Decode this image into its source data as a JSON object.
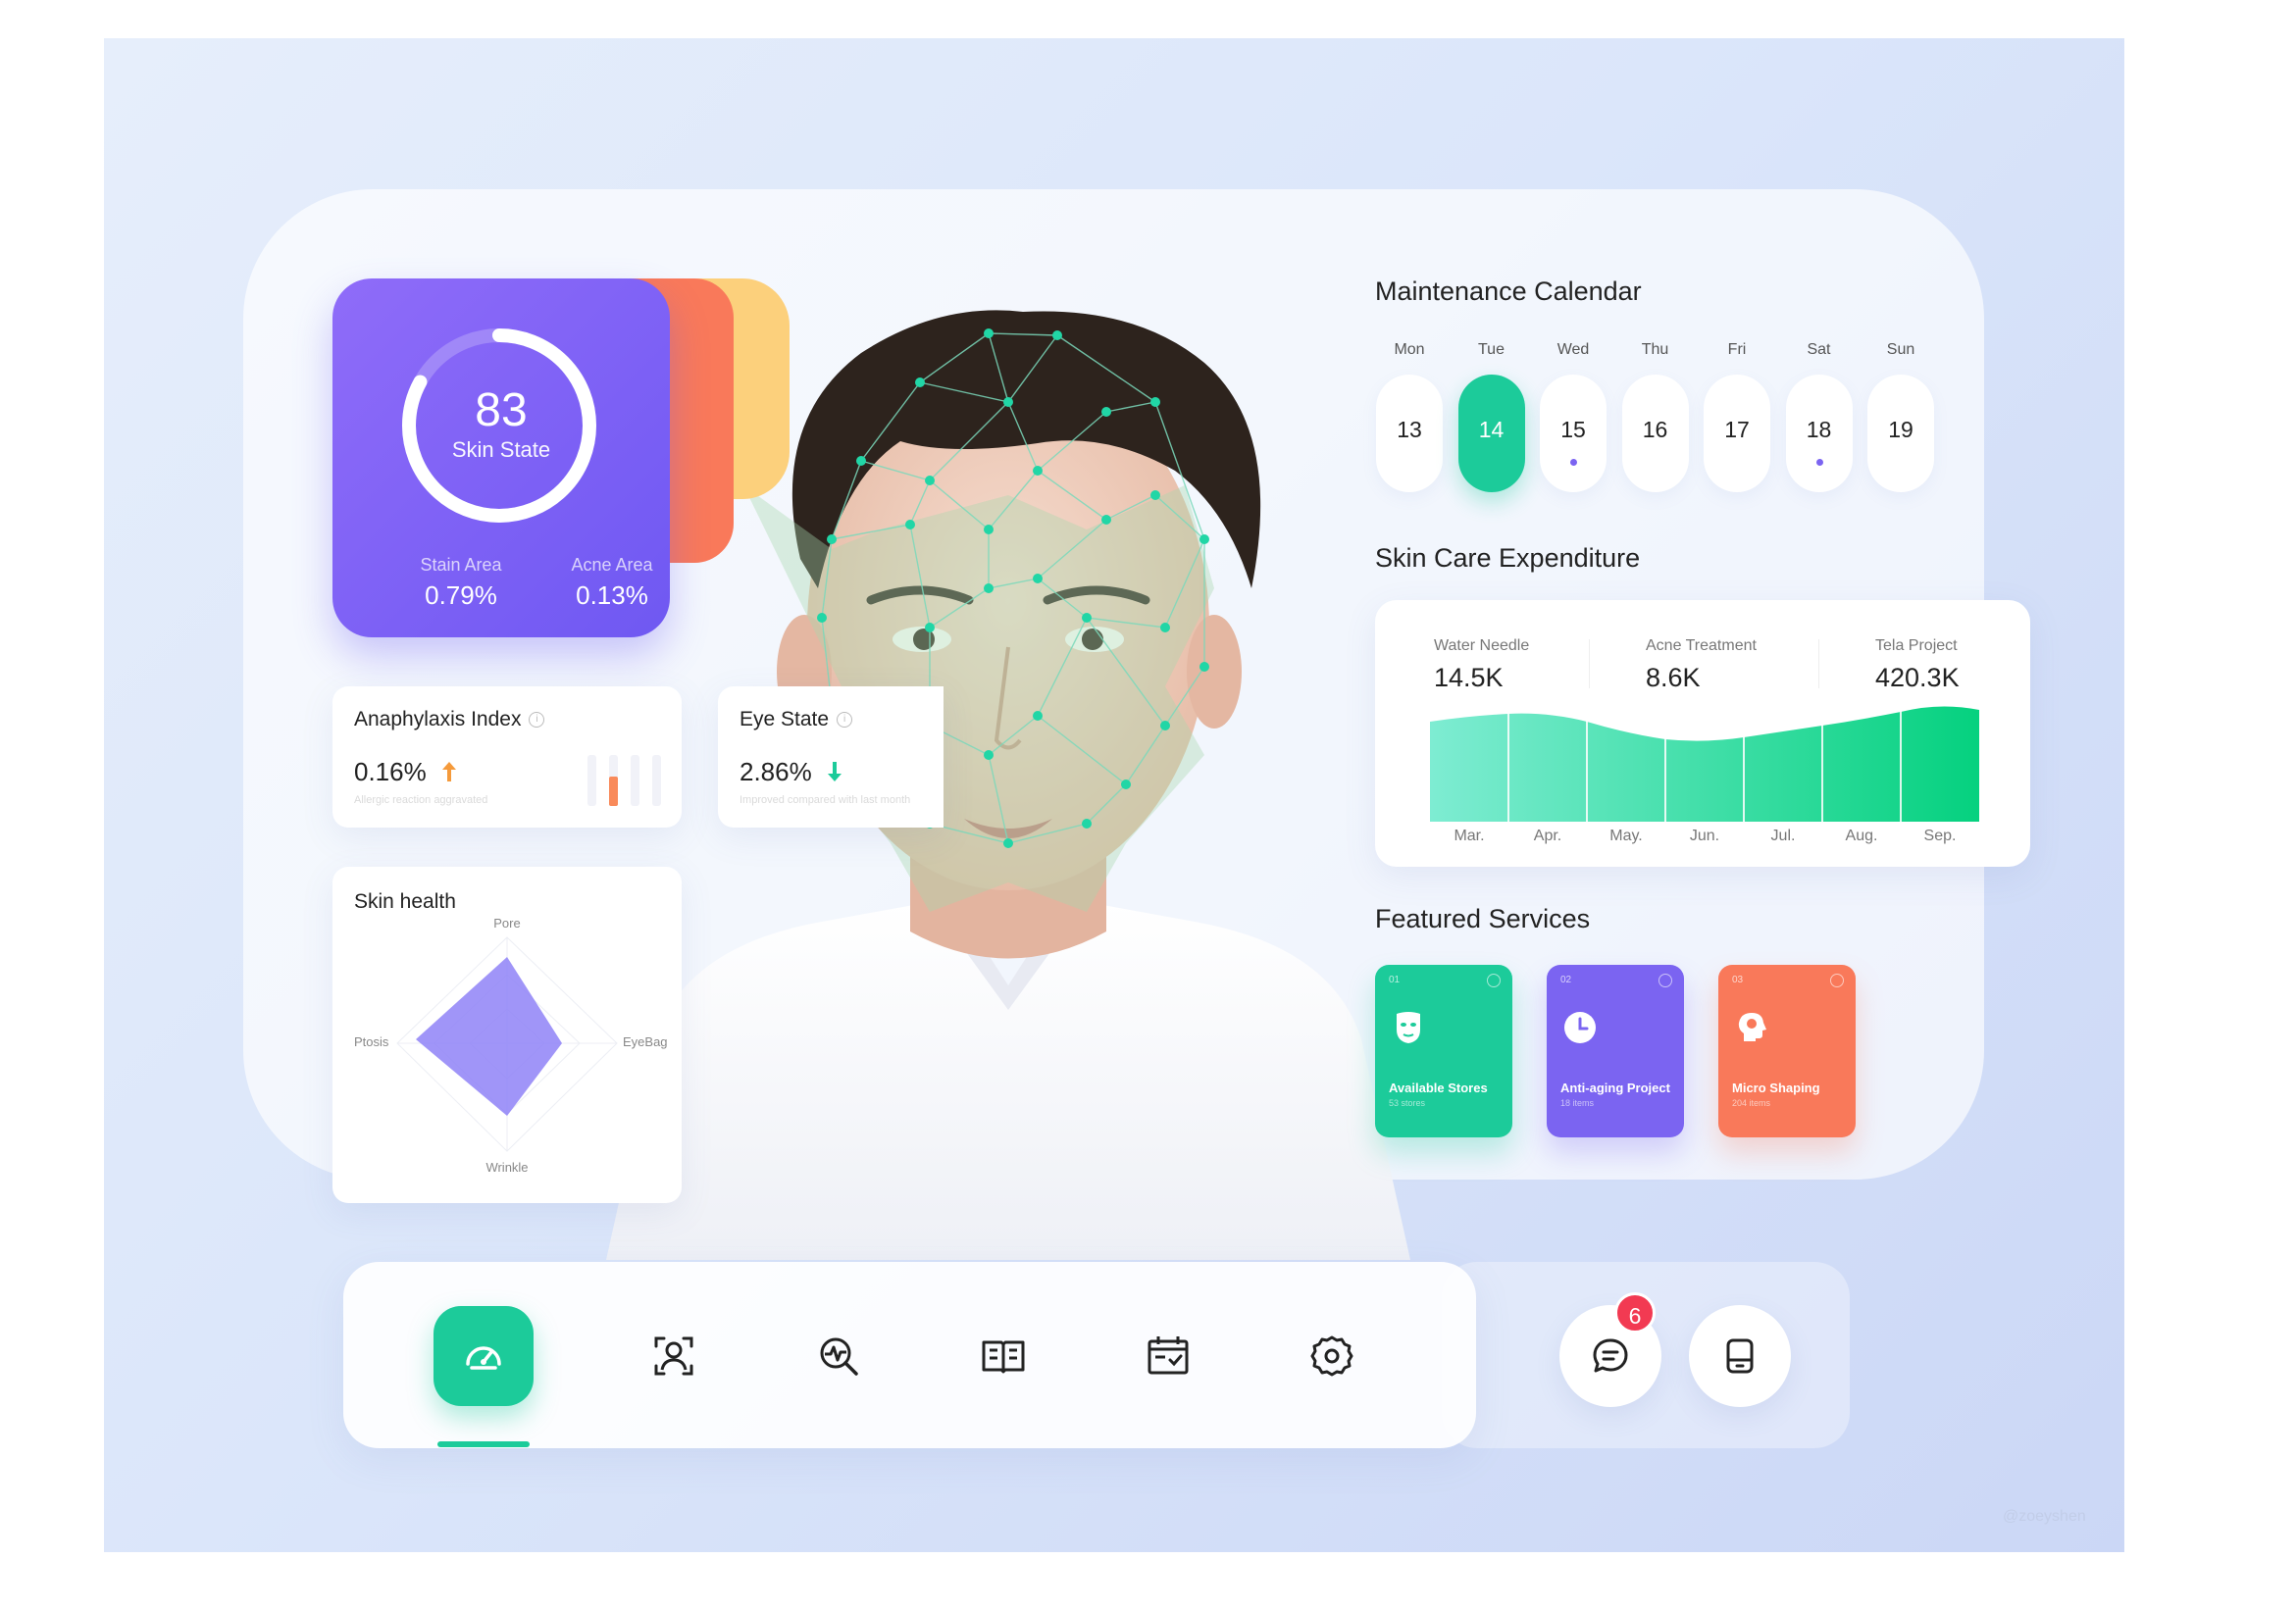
{
  "colors": {
    "accent_green": "#1ccb9a",
    "accent_purple": "#7b64f1",
    "accent_orange": "#f9795a",
    "accent_yellow": "#fcd07c",
    "badge_red": "#f23a52"
  },
  "skin_state": {
    "score": "83",
    "score_fraction": 0.83,
    "label": "Skin State",
    "stain_label": "Stain Area",
    "stain_value": "0.79%",
    "acne_label": "Acne Area",
    "acne_value": "0.13%"
  },
  "anaphylaxis": {
    "title": "Anaphylaxis Index",
    "value": "0.16%",
    "trend_icon": "arrow-up-icon",
    "note": "Allergic reaction aggravated"
  },
  "eye_state": {
    "title": "Eye State",
    "value": "2.86%",
    "trend_icon": "arrow-down-icon",
    "note": "Improved compared with last month"
  },
  "skin_health": {
    "title": "Skin health",
    "axes": [
      "Pore",
      "EyeBag",
      "Wrinkle",
      "Ptosis"
    ]
  },
  "calendar": {
    "title": "Maintenance Calendar",
    "days": [
      {
        "name": "Mon",
        "num": "13",
        "active": false,
        "dot": false
      },
      {
        "name": "Tue",
        "num": "14",
        "active": true,
        "dot": false
      },
      {
        "name": "Wed",
        "num": "15",
        "active": false,
        "dot": true
      },
      {
        "name": "Thu",
        "num": "16",
        "active": false,
        "dot": false
      },
      {
        "name": "Fri",
        "num": "17",
        "active": false,
        "dot": false
      },
      {
        "name": "Sat",
        "num": "18",
        "active": false,
        "dot": true
      },
      {
        "name": "Sun",
        "num": "19",
        "active": false,
        "dot": false
      }
    ]
  },
  "expenditure": {
    "title": "Skin Care Expenditure",
    "stats": [
      {
        "label": "Water Needle",
        "value": "14.5K"
      },
      {
        "label": "Acne Treatment",
        "value": "8.6K"
      },
      {
        "label": "Tela Project",
        "value": "420.3K"
      }
    ],
    "months": [
      "Mar.",
      "Apr.",
      "May.",
      "Jun.",
      "Jul.",
      "Aug.",
      "Sep."
    ]
  },
  "featured": {
    "title": "Featured Services",
    "services": [
      {
        "num": "01",
        "name": "Available Stores",
        "sub": "53 stores",
        "color": "#1ccb9a",
        "icon": "mask-icon"
      },
      {
        "num": "02",
        "name": "Anti-aging Project",
        "sub": "18 items",
        "color": "#7b64f1",
        "icon": "clock-icon"
      },
      {
        "num": "03",
        "name": "Micro Shaping",
        "sub": "204 items",
        "color": "#f9795a",
        "icon": "head-profile-icon"
      }
    ]
  },
  "nav": {
    "items": [
      "dashboard-icon",
      "face-scan-icon",
      "analysis-search-icon",
      "book-icon",
      "calendar-check-icon",
      "gear-icon"
    ],
    "message_count": "6"
  },
  "watermark": "@zoeyshen"
}
